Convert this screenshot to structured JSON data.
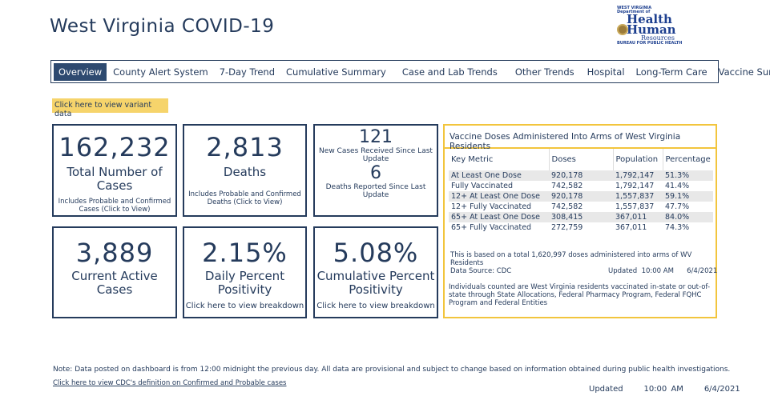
{
  "title": "West Virginia COVID-19",
  "logo": {
    "line1": "WEST VIRGINIA",
    "line2": "Department of",
    "line3": "Health",
    "line4": "Human",
    "line5": "Resources",
    "line6": "BUREAU FOR PUBLIC HEALTH"
  },
  "tabs": [
    "Overview",
    "County Alert System",
    "7-Day Trend",
    "Cumulative Summary",
    "Case and Lab Trends",
    "Other Trends",
    "Hospital",
    "Long-Term Care",
    "Vaccine Summary"
  ],
  "variant_button": "Click here to view variant data",
  "cards": {
    "total_cases": {
      "value": "162,232",
      "label": "Total Number of Cases",
      "sub": "Includes Probable and Confirmed Cases (Click to View)"
    },
    "deaths": {
      "value": "2,813",
      "label": "Deaths",
      "sub": "Includes Probable and Confirmed Deaths (Click to View)"
    },
    "new_cases": {
      "value": "121",
      "label": "New Cases Received Since Last Update",
      "deaths_value": "6",
      "deaths_label": "Deaths Reported Since Last Update"
    },
    "active": {
      "value": "3,889",
      "label": "Current Active Cases"
    },
    "daily_pos": {
      "value": "2.15%",
      "label": "Daily Percent Positivity",
      "link": "Click here to view breakdown"
    },
    "cum_pos": {
      "value": "5.08%",
      "label": "Cumulative Percent Positivity",
      "link": "Click here to view breakdown"
    }
  },
  "vaccine": {
    "title": "Vaccine Doses Administered Into Arms of West Virginia Residents",
    "headers": [
      "Key Metric",
      "Doses",
      "Population",
      "Percentage"
    ],
    "rows": [
      [
        "At Least One Dose",
        "920,178",
        "1,792,147",
        "51.3%"
      ],
      [
        "Fully Vaccinated",
        "742,582",
        "1,792,147",
        "41.4%"
      ],
      [
        "12+ At Least One Dose",
        "920,178",
        "1,557,837",
        "59.1%"
      ],
      [
        "12+ Fully Vaccinated",
        "742,582",
        "1,557,837",
        "47.7%"
      ],
      [
        "65+ At Least One Dose",
        "308,415",
        "367,011",
        "84.0%"
      ],
      [
        "65+ Fully Vaccinated",
        "272,759",
        "367,011",
        "74.3%"
      ]
    ],
    "total_text": "This is based on a total  1,620,997  doses administered into arms of WV Residents",
    "source": "Data Source: CDC",
    "updated": "Updated  10:00 AM      6/4/2021",
    "note": "Individuals counted are West Virginia residents vaccinated in-state or out-of-state through State Allocations, Federal Pharmacy Program, Federal FQHC Program and Federal Entities"
  },
  "footer": {
    "note": "Note: Data posted on dashboard is from 12:00 midnight the previous day. All data are provisional and subject to change based on information obtained during public health investigations.",
    "cdc_link": "Click here to view CDC's definition on Confirmed and Probable cases",
    "updated": "Updated     10:00 AM     6/4/2021"
  }
}
